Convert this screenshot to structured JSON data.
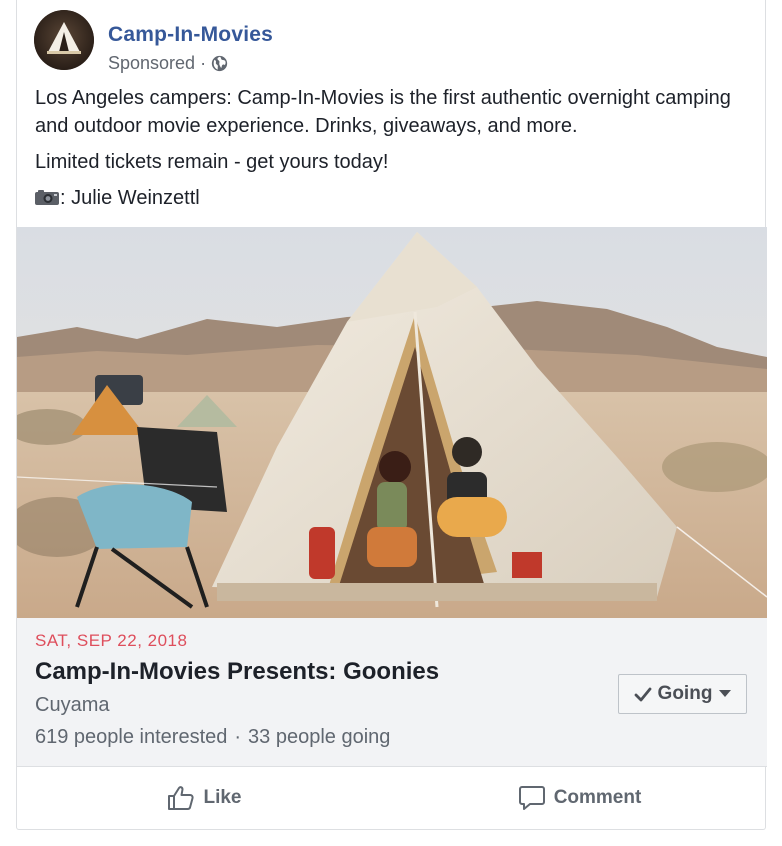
{
  "post": {
    "page_name": "Camp-In-Movies",
    "sponsored_label": "Sponsored",
    "separator": "·",
    "paragraphs": [
      "Los Angeles campers: Camp-In-Movies is the first authentic overnight camping and outdoor movie experience. Drinks, giveaways, and more.",
      "Limited tickets remain - get yours today!"
    ],
    "photo_credit": ": Julie Weinzettl",
    "icons": {
      "audience": "globe-icon",
      "credit": "camera-icon"
    }
  },
  "event": {
    "date": "SAT, SEP 22, 2018",
    "title": "Camp-In-Movies Presents: Goonies",
    "location": "Cuyama",
    "interested": "619 people interested",
    "separator": "·",
    "going_count": "33 people going",
    "rsvp_label": "Going",
    "date_color": "#de4e5c"
  },
  "actions": {
    "like_label": "Like",
    "comment_label": "Comment"
  },
  "colors": {
    "link": "#365899",
    "secondary_text": "#606770",
    "event_bg": "#f2f3f5"
  }
}
